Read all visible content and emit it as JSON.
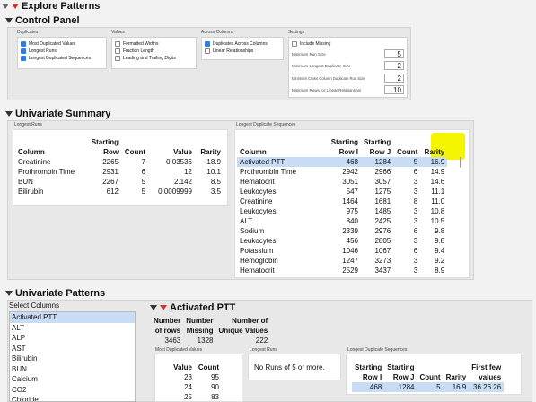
{
  "title": "Explore Patterns",
  "control_panel": {
    "title": "Control Panel",
    "duplicates": {
      "label": "Duplicates",
      "options": [
        {
          "label": "Most Duplicated Values",
          "checked": true
        },
        {
          "label": "Longest Runs",
          "checked": true
        },
        {
          "label": "Longest Duplicated Sequences",
          "checked": true
        }
      ]
    },
    "values": {
      "label": "Values",
      "options": [
        {
          "label": "Formatted Widths",
          "checked": false
        },
        {
          "label": "Fraction Length",
          "checked": false
        },
        {
          "label": "Leading and Trailing Digits",
          "checked": false
        }
      ]
    },
    "across_columns": {
      "label": "Across Columns",
      "options": [
        {
          "label": "Duplicates Across Columns",
          "checked": true
        },
        {
          "label": "Linear Relationships",
          "checked": false
        }
      ]
    },
    "settings": {
      "label": "Settings",
      "include_missing": "Include Missing",
      "fields": [
        {
          "label": "Minimum Run Size",
          "value": "5"
        },
        {
          "label": "Minimum Longest Duplicate Size",
          "value": "2"
        },
        {
          "label": "Minimum Cross Column Duplicate Run Size",
          "value": "2"
        },
        {
          "label": "Minimum Rows for Linear Relationship",
          "value": "10"
        }
      ]
    }
  },
  "univariate_summary": {
    "title": "Univariate Summary",
    "longest_runs": {
      "label": "Longest Runs",
      "headers": {
        "column": "Column",
        "start_top": "Starting",
        "start_bottom": "Row",
        "count": "Count",
        "value": "Value",
        "rarity": "Rarity"
      },
      "rows": [
        {
          "column": "Creatinine",
          "row": "2265",
          "count": "7",
          "value": "0.03536",
          "rarity": "18.9"
        },
        {
          "column": "Prothrombin Time",
          "row": "2931",
          "count": "6",
          "value": "12",
          "rarity": "10.1"
        },
        {
          "column": "BUN",
          "row": "2267",
          "count": "5",
          "value": "2.142",
          "rarity": "8.5"
        },
        {
          "column": "Bilirubin",
          "row": "612",
          "count": "5",
          "value": "0.0009999",
          "rarity": "3.5"
        }
      ]
    },
    "longest_sequences": {
      "label": "Longest Duplicate Sequences",
      "headers": {
        "column": "Column",
        "start_top_i": "Starting",
        "row_i": "Row I",
        "start_top_j": "Starting",
        "row_j": "Row J",
        "count": "Count",
        "rarity": "Rarity"
      },
      "rows": [
        {
          "column": "Activated PTT",
          "row_i": "468",
          "row_j": "1284",
          "count": "5",
          "rarity": "16.9"
        },
        {
          "column": "Prothrombin Time",
          "row_i": "2942",
          "row_j": "2966",
          "count": "6",
          "rarity": "14.9"
        },
        {
          "column": "Hematocrit",
          "row_i": "3051",
          "row_j": "3057",
          "count": "3",
          "rarity": "14.6"
        },
        {
          "column": "Leukocytes",
          "row_i": "547",
          "row_j": "1275",
          "count": "3",
          "rarity": "11.1"
        },
        {
          "column": "Creatinine",
          "row_i": "1464",
          "row_j": "1681",
          "count": "8",
          "rarity": "11.0"
        },
        {
          "column": "Leukocytes",
          "row_i": "975",
          "row_j": "1485",
          "count": "3",
          "rarity": "10.8"
        },
        {
          "column": "ALT",
          "row_i": "840",
          "row_j": "2425",
          "count": "3",
          "rarity": "10.5"
        },
        {
          "column": "Sodium",
          "row_i": "2339",
          "row_j": "2976",
          "count": "6",
          "rarity": "9.8"
        },
        {
          "column": "Leukocytes",
          "row_i": "456",
          "row_j": "2805",
          "count": "3",
          "rarity": "9.8"
        },
        {
          "column": "Potassium",
          "row_i": "1046",
          "row_j": "1067",
          "count": "6",
          "rarity": "9.4"
        },
        {
          "column": "Hemoglobin",
          "row_i": "1247",
          "row_j": "3273",
          "count": "3",
          "rarity": "9.2"
        },
        {
          "column": "Hematocrit",
          "row_i": "2529",
          "row_j": "3437",
          "count": "3",
          "rarity": "8.9"
        }
      ]
    }
  },
  "univariate_patterns": {
    "title": "Univariate Patterns",
    "select_columns_label": "Select Columns",
    "columns": [
      "Activated PTT",
      "ALT",
      "ALP",
      "AST",
      "Bilirubin",
      "BUN",
      "Calcium",
      "CO2",
      "Chloride"
    ],
    "selected_column": "Activated PTT",
    "detail": {
      "title": "Activated PTT",
      "stats_headers": {
        "rows_top": "Number",
        "rows_bottom": "of rows",
        "missing_top": "Number",
        "missing_bottom": "Missing",
        "unique_top": "Number of",
        "unique_bottom": "Unique Values"
      },
      "stats": {
        "rows": "3463",
        "missing": "1328",
        "unique": "222"
      },
      "most_duplicated": {
        "label": "Most Duplicated Values",
        "headers": {
          "value": "Value",
          "count": "Count"
        },
        "rows": [
          {
            "value": "23",
            "count": "95"
          },
          {
            "value": "24",
            "count": "90"
          },
          {
            "value": "25",
            "count": "83"
          }
        ]
      },
      "longest_runs": {
        "label": "Longest Runs",
        "message": "No Runs of 5 or more."
      },
      "longest_sequences": {
        "label": "Longest Duplicate Sequences",
        "headers": {
          "start_i": "Starting",
          "row_i": "Row I",
          "start_j": "Starting",
          "row_j": "Row J",
          "count": "Count",
          "rarity": "Rarity",
          "first_top": "First few",
          "first_bottom": "values"
        },
        "rows": [
          {
            "row_i": "468",
            "row_j": "1284",
            "count": "5",
            "rarity": "16.9",
            "first": "36 26 26"
          }
        ]
      }
    }
  }
}
